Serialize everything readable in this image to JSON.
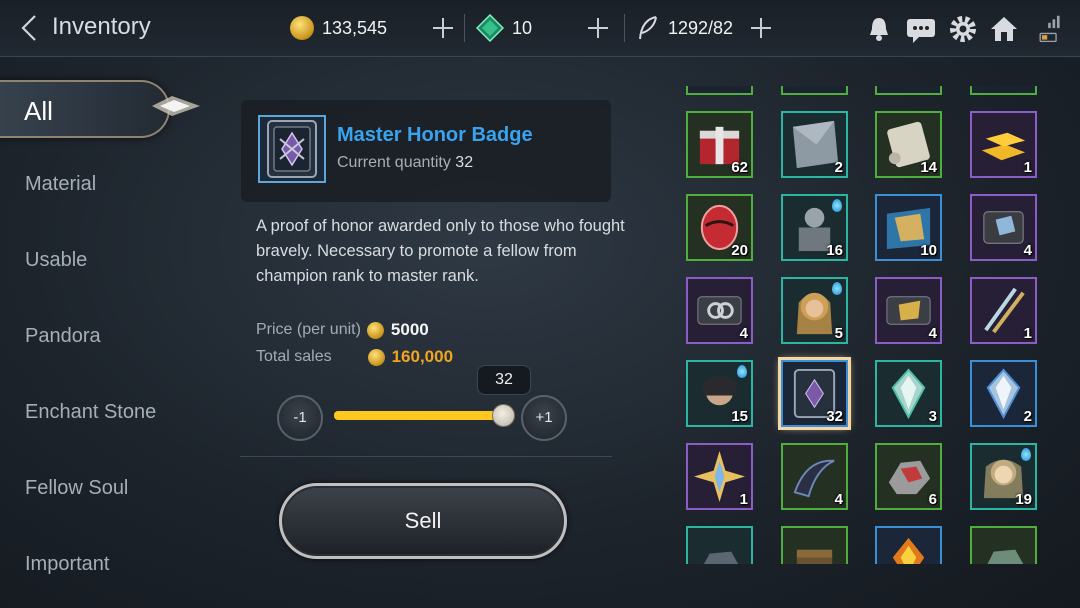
{
  "header": {
    "title": "Inventory",
    "gold": "133,545",
    "gems": "10",
    "stamina": "1292/82"
  },
  "sidebar": {
    "items": [
      {
        "label": "All"
      },
      {
        "label": "Material"
      },
      {
        "label": "Usable"
      },
      {
        "label": "Pandora"
      },
      {
        "label": "Enchant Stone"
      },
      {
        "label": "Fellow Soul"
      },
      {
        "label": "Important"
      }
    ]
  },
  "item": {
    "name": "Master Honor Badge",
    "qty_label": "Current quantity",
    "qty": "32",
    "description": "A proof of honor awarded only to those who fought bravely. Necessary to promote a fellow from champion rank to master rank.",
    "price_label": "Price (per unit)",
    "price": "5000",
    "total_label": "Total sales",
    "total": "160,000"
  },
  "slider": {
    "minus_label": "-1",
    "plus_label": "+1",
    "value": "32",
    "fill_fraction": 1.0
  },
  "sell_label": "Sell",
  "colors": {
    "accent_blue": "#3aa3ee",
    "total_orange": "#f0a520",
    "slider_yellow": "#ffc81e",
    "border_green": "#4fae3c",
    "border_teal": "#2bb5a3",
    "border_blue": "#3b8fd8",
    "border_purple": "#8c5cc7"
  },
  "grid": {
    "rows": [
      [
        {
          "qty": "62",
          "border": "green",
          "icon": "red-gift-icon"
        },
        {
          "qty": "2",
          "border": "teal",
          "icon": "metal-plate-icon"
        },
        {
          "qty": "14",
          "border": "green",
          "icon": "scroll-icon"
        },
        {
          "qty": "1",
          "border": "purple",
          "icon": "gold-bars-icon"
        }
      ],
      [
        {
          "qty": "20",
          "border": "green",
          "icon": "red-egg-icon"
        },
        {
          "qty": "16",
          "border": "teal",
          "icon": "armored-warrior-icon"
        },
        {
          "qty": "10",
          "border": "blue",
          "icon": "treasure-map-icon"
        },
        {
          "qty": "4",
          "border": "purple",
          "icon": "crystal-card-icon"
        }
      ],
      [
        {
          "qty": "4",
          "border": "purple",
          "icon": "rings-card-icon"
        },
        {
          "qty": "5",
          "border": "teal",
          "icon": "elf-portrait-icon"
        },
        {
          "qty": "4",
          "border": "purple",
          "icon": "gold-card-icon"
        },
        {
          "qty": "1",
          "border": "purple",
          "icon": "twin-swords-icon"
        }
      ],
      [
        {
          "qty": "15",
          "border": "teal",
          "icon": "dark-hero-portrait-icon"
        },
        {
          "qty": "32",
          "border": "blue",
          "icon": "honor-badge-icon",
          "selected": true
        },
        {
          "qty": "3",
          "border": "teal",
          "icon": "green-stone-icon"
        },
        {
          "qty": "2",
          "border": "blue",
          "icon": "blue-stone-icon"
        }
      ],
      [
        {
          "qty": "1",
          "border": "purple",
          "icon": "star-crystal-icon"
        },
        {
          "qty": "4",
          "border": "green",
          "icon": "dark-horn-icon"
        },
        {
          "qty": "6",
          "border": "green",
          "icon": "red-ore-icon"
        },
        {
          "qty": "19",
          "border": "teal",
          "icon": "elf-warrior-portrait-icon"
        }
      ],
      [
        {
          "qty": "",
          "border": "teal",
          "icon": "rock-icon"
        },
        {
          "qty": "",
          "border": "green",
          "icon": "chest-icon"
        },
        {
          "qty": "",
          "border": "blue",
          "icon": "fire-gem-icon"
        },
        {
          "qty": "",
          "border": "green",
          "icon": "green-ore-icon"
        }
      ]
    ]
  }
}
